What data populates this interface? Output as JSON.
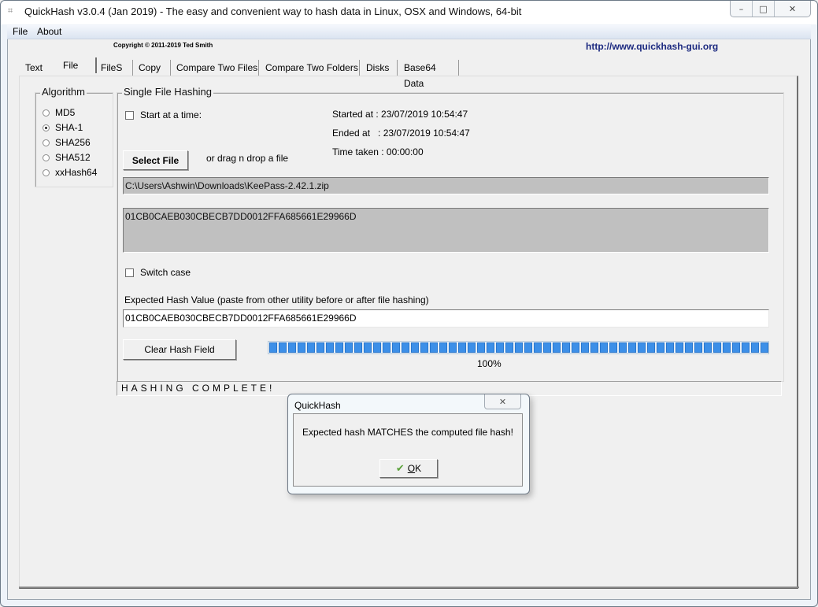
{
  "window": {
    "title": "QuickHash v3.0.4 (Jan 2019) - The easy and convenient way to hash data in Linux, OSX and Windows, 64-bit",
    "app_icon": "hash-icon",
    "caption_buttons": {
      "minimize": "–",
      "maximize": "□",
      "close": "✕"
    }
  },
  "menu": {
    "items": [
      {
        "label": "File"
      },
      {
        "label": "About"
      }
    ]
  },
  "header": {
    "copyright": "Copyright © 2011-2019  Ted Smith",
    "url": "http://www.quickhash-gui.org"
  },
  "tabs": [
    {
      "label": "Text",
      "active": false
    },
    {
      "label": "File",
      "active": true
    },
    {
      "label": "FileS",
      "active": false
    },
    {
      "label": "Copy",
      "active": false
    },
    {
      "label": "Compare Two Files",
      "active": false
    },
    {
      "label": "Compare Two Folders",
      "active": false
    },
    {
      "label": "Disks",
      "active": false
    },
    {
      "label": "Base64 Data",
      "active": false
    }
  ],
  "algorithm": {
    "legend": "Algorithm",
    "options": [
      {
        "label": "MD5",
        "selected": false
      },
      {
        "label": "SHA-1",
        "selected": true
      },
      {
        "label": "SHA256",
        "selected": false
      },
      {
        "label": "SHA512",
        "selected": false
      },
      {
        "label": "xxHash64",
        "selected": false
      }
    ]
  },
  "single_file": {
    "legend": "Single File Hashing",
    "start_at_time_label": "Start at a time:",
    "start_at_time_checked": false,
    "started_at": "Started at : 23/07/2019 10:54:47",
    "ended_at": "Ended at   : 23/07/2019 10:54:47",
    "time_taken": "Time taken : 00:00:00",
    "select_file_label": "Select File",
    "drag_drop_label": "or drag n drop a file",
    "file_path": "C:\\Users\\Ashwin\\Downloads\\KeePass-2.42.1.zip",
    "computed_hash": "01CB0CAEB030CBECB7DD0012FFA685661E29966D",
    "switch_case_label": "Switch case",
    "switch_case_checked": false,
    "expected_hash_label": "Expected Hash Value (paste from other utility before or after file hashing)",
    "expected_hash_value": "01CB0CAEB030CBECB7DD0012FFA685661E29966D",
    "clear_hash_label": "Clear Hash Field",
    "progress_percent": 100,
    "progress_text": "100%",
    "status": "HASHING COMPLETE!"
  },
  "dialog": {
    "title": "QuickHash",
    "close_glyph": "✕",
    "message": "Expected hash MATCHES the computed file hash!",
    "ok_label": "OK",
    "ok_icon": "✔"
  },
  "colors": {
    "progress_fill": "#3c8fe8",
    "link": "#1c2a80",
    "ok_check": "#5aa13a"
  }
}
